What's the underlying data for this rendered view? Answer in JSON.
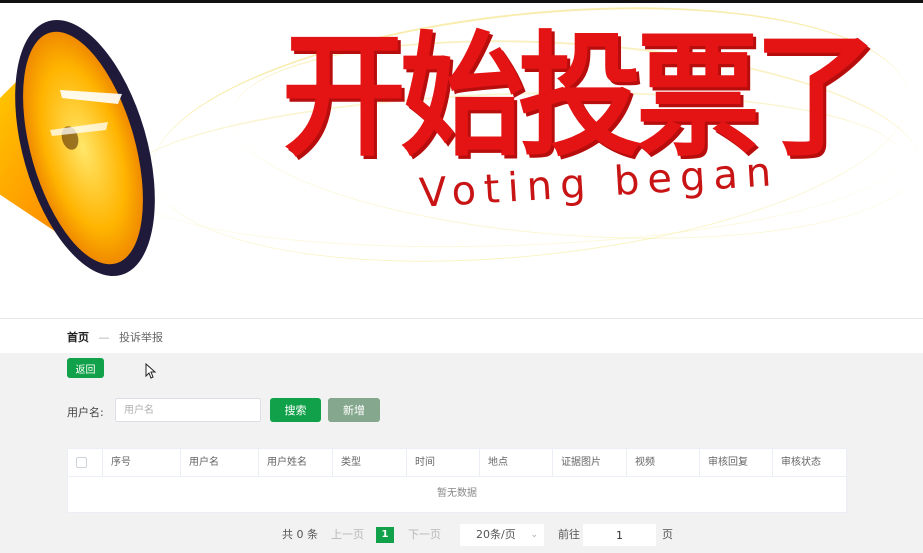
{
  "banner": {
    "title": "开始投票了",
    "subtitle": "Voting began"
  },
  "breadcrumb": {
    "home": "首页",
    "separator": "—",
    "current": "投诉举报"
  },
  "toolbar": {
    "back_label": "返回"
  },
  "search": {
    "label": "用户名:",
    "placeholder": "用户名",
    "value": "",
    "search_label": "搜索",
    "add_label": "新增"
  },
  "table": {
    "columns": [
      "序号",
      "用户名",
      "用户姓名",
      "类型",
      "时间",
      "地点",
      "证据图片",
      "视频",
      "审核回复",
      "审核状态"
    ],
    "empty_text": "暂无数据"
  },
  "pagination": {
    "total": "共 0 条",
    "prev": "上一页",
    "current_page": "1",
    "next": "下一页",
    "page_size": "20条/页",
    "goto": "前往",
    "goto_value": "1",
    "page_suffix": "页"
  },
  "icons": {
    "megaphone": "megaphone-icon",
    "cursor": "cursor-icon",
    "chevron": "chevron-down-icon"
  },
  "colors": {
    "primary": "#11a14a",
    "secondary": "#85a78e",
    "banner_red": "#e41414",
    "background": "#f2f2f2"
  }
}
